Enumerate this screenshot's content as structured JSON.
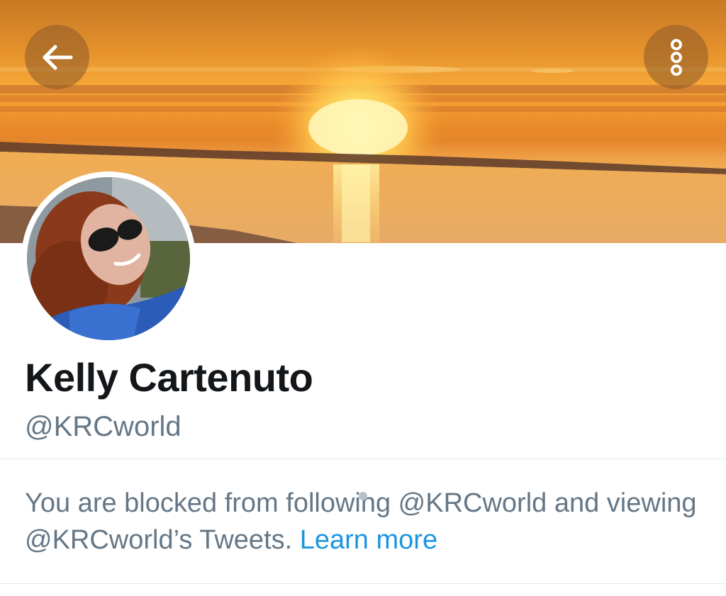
{
  "header": {
    "back_icon": "arrow-left-icon",
    "more_icon": "vertical-dots-icon",
    "button_color": "#8c5a28"
  },
  "profile": {
    "display_name": "Kelly Cartenuto",
    "handle": "@KRCworld"
  },
  "blocked_notice": {
    "text": "You are blocked from following @KRCworld and viewing @KRCworld’s Tweets.",
    "link_label": "Learn more",
    "link_color": "#1b95e0",
    "text_color": "#657786"
  }
}
